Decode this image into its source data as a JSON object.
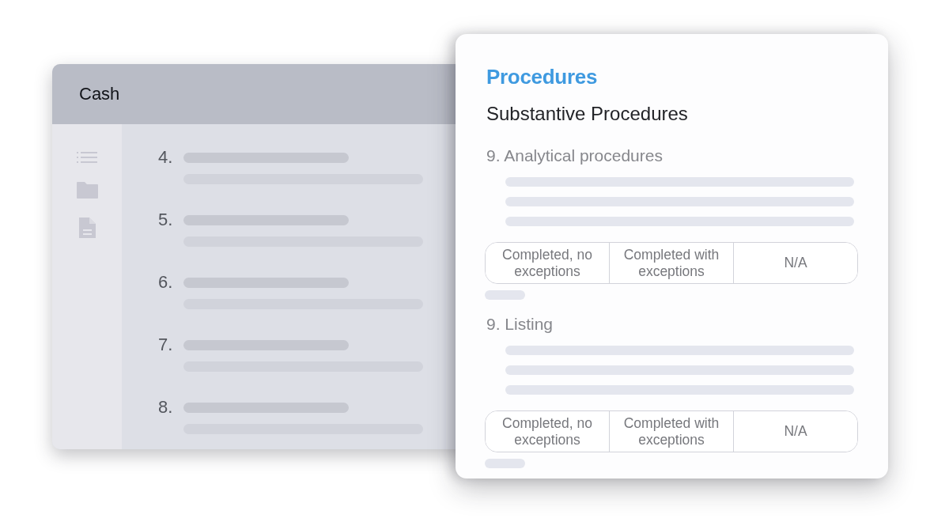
{
  "back_window": {
    "title": "Cash",
    "items": [
      {
        "number": "4."
      },
      {
        "number": "5."
      },
      {
        "number": "6."
      },
      {
        "number": "7."
      },
      {
        "number": "8."
      }
    ]
  },
  "front_card": {
    "title": "Procedures",
    "subtitle": "Substantive Procedures",
    "procedures": [
      {
        "heading": "9. Analytical procedures",
        "options": [
          {
            "label": "Completed, no exceptions",
            "selected": false
          },
          {
            "label": "Completed with exceptions",
            "selected": false
          },
          {
            "label": "N/A",
            "selected": false
          }
        ]
      },
      {
        "heading": "9. Listing",
        "options": [
          {
            "label": "Completed, no exceptions",
            "selected": false
          },
          {
            "label": "Completed with exceptions",
            "selected": false
          },
          {
            "label": "N/A",
            "selected": false
          }
        ]
      }
    ]
  }
}
